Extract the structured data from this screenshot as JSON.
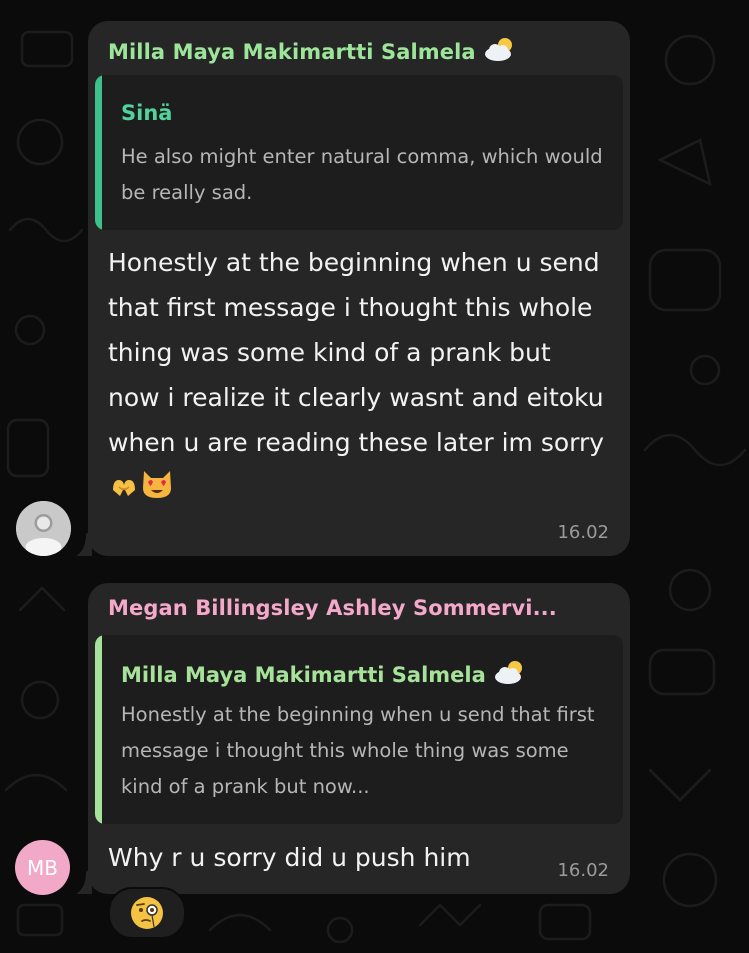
{
  "chat": {
    "messages": [
      {
        "sender": "Milla Maya Makimartti Salmela",
        "sender_status_icon": "sun-behind-cloud-icon",
        "reply_to": {
          "author": "Sinä",
          "text": "He also might enter natural comma, which would be really sad."
        },
        "text": "Honestly at the beginning when u send that first message i thought this whole thing was some kind of a prank but now i realize it clearly wasnt and eitoku when u are reading these later im sorry",
        "inline_emojis": [
          "heart-hands-icon",
          "heart-eyes-cat-icon"
        ],
        "time": "16.02",
        "avatar": "default-profile-icon"
      },
      {
        "sender": "Megan Billingsley Ashley Sommervi...",
        "reply_to": {
          "author": "Milla Maya Makimartti Salmela",
          "author_status_icon": "sun-behind-cloud-icon",
          "text": "Honestly at the beginning when u send that first message i thought this whole thing was some kind of a prank but now..."
        },
        "text": "Why r u sorry did u push him",
        "time": "16.02",
        "avatar_initials": "MB",
        "reaction": "face-with-monocle-icon"
      }
    ]
  },
  "colors": {
    "background": "#0b0b0b",
    "bubble": "#262626",
    "quote_bg": "#1d1d1d",
    "sender1": "#9de59a",
    "sender2": "#f4a8ca",
    "quote1_author": "#52d39b",
    "quote2_bar": "#a6e29a",
    "avatar2": "#f1a9c7"
  }
}
